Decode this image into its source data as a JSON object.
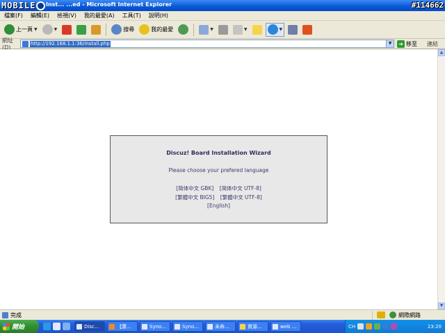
{
  "titlebar": {
    "logo_text": "MOBILE",
    "window_title": "Inst... ...ed - Microsoft Internet Explorer",
    "stamp": "#114662"
  },
  "menu": [
    {
      "label": "檔案(F)"
    },
    {
      "label": "編輯(E)"
    },
    {
      "label": "檢視(V)"
    },
    {
      "label": "我的最愛(A)"
    },
    {
      "label": "工具(T)"
    },
    {
      "label": "說明(H)"
    }
  ],
  "toolbar": {
    "back_label": "上一頁",
    "search_label": "搜尋",
    "favorites_label": "我的最愛"
  },
  "address": {
    "label": "網址(D)",
    "url": "http://192.168.1.1:36/install.php",
    "go_label": "移至",
    "links_label": "連結"
  },
  "wizard": {
    "title": "Discuz! Board Installation Wizard",
    "prompt": "Please choose your prefered language",
    "options": [
      {
        "label": "[简体中文 GBK]"
      },
      {
        "label": "[简体中文 UTF-8]"
      },
      {
        "label": "[繁體中文 BIG5]"
      },
      {
        "label": "[繁體中文 UTF-8]"
      },
      {
        "label": "[English]"
      }
    ]
  },
  "status": {
    "text": "完成",
    "zone": "網際網路"
  },
  "taskbar": {
    "start_label": "開始",
    "tasks": [
      {
        "label": "Disc..."
      },
      {
        "label": "【康..."
      },
      {
        "label": "Syno..."
      },
      {
        "label": "Syno..."
      },
      {
        "label": "未命..."
      },
      {
        "label": "資源..."
      },
      {
        "label": "web ..."
      }
    ],
    "ime": "CH",
    "clock": "23:20"
  },
  "colors": {
    "title_blue": "#0a5bd8",
    "taskbar_blue": "#245edb",
    "start_green": "#2f8f2f",
    "wizard_bg": "#e8e8e8",
    "link_text": "#3a3a6a"
  }
}
